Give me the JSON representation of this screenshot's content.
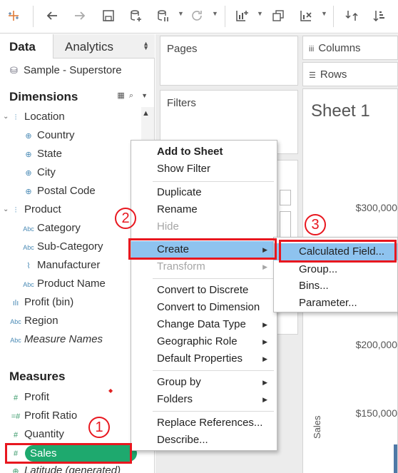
{
  "toolbar": {
    "icons": [
      "tableau-logo-icon",
      "undo-icon",
      "redo-icon",
      "save-icon",
      "new-datasource-icon",
      "pause-updates-icon",
      "refresh-icon",
      "new-worksheet-icon",
      "duplicate-icon",
      "clear-sheet-icon",
      "swap-icon",
      "sort-ascending-icon"
    ]
  },
  "left_pane": {
    "tab_data": "Data",
    "tab_analytics": "Analytics",
    "datasource": "Sample - Superstore",
    "dimensions_header": "Dimensions",
    "measures_header": "Measures",
    "dimensions": [
      {
        "label": "Location",
        "icon": "hierarchy-icon",
        "level": 0
      },
      {
        "label": "Country",
        "icon": "globe-icon",
        "level": 1
      },
      {
        "label": "State",
        "icon": "globe-icon",
        "level": 1
      },
      {
        "label": "City",
        "icon": "globe-icon",
        "level": 1
      },
      {
        "label": "Postal Code",
        "icon": "globe-icon",
        "level": 1
      },
      {
        "label": "Product",
        "icon": "hierarchy-icon",
        "level": 0
      },
      {
        "label": "Category",
        "icon": "abc-icon",
        "level": 1
      },
      {
        "label": "Sub-Category",
        "icon": "abc-icon",
        "level": 1
      },
      {
        "label": "Manufacturer",
        "icon": "paperclip-icon",
        "level": 1
      },
      {
        "label": "Product Name",
        "icon": "abc-icon",
        "level": 1
      },
      {
        "label": "Profit (bin)",
        "icon": "bin-icon",
        "level": 0
      },
      {
        "label": "Region",
        "icon": "abc-icon",
        "level": 0
      },
      {
        "label": "Measure Names",
        "icon": "abc-icon",
        "level": 0
      }
    ],
    "measures": [
      {
        "label": "Profit"
      },
      {
        "label": "Profit Ratio"
      },
      {
        "label": "Quantity"
      },
      {
        "label": "Sales"
      },
      {
        "label": "Latitude (generated)"
      }
    ]
  },
  "shelves": {
    "pages": "Pages",
    "filters": "Filters",
    "columns": "Columns",
    "rows": "Rows"
  },
  "view": {
    "sheet_title": "Sheet 1",
    "y_axis_title": "Sales",
    "y_ticks": [
      "$300,000",
      "$200,000",
      "$150,000"
    ]
  },
  "context_menu": {
    "items": [
      {
        "label": "Add to Sheet",
        "bold": true
      },
      {
        "label": "Show Filter"
      },
      {
        "label": "Duplicate"
      },
      {
        "label": "Rename"
      },
      {
        "label": "Hide",
        "disabled": true
      },
      {
        "label": "Create",
        "highlighted": true,
        "submenu": true
      },
      {
        "label": "Transform",
        "disabled": true,
        "submenu": true
      },
      {
        "label": "Convert to Discrete"
      },
      {
        "label": "Convert to Dimension"
      },
      {
        "label": "Change Data Type",
        "submenu": true
      },
      {
        "label": "Geographic Role",
        "submenu": true
      },
      {
        "label": "Default Properties",
        "submenu": true
      },
      {
        "label": "Group by",
        "submenu": true
      },
      {
        "label": "Folders",
        "submenu": true
      },
      {
        "label": "Replace References..."
      },
      {
        "label": "Describe..."
      }
    ]
  },
  "create_submenu": {
    "items": [
      {
        "label": "Calculated Field...",
        "highlighted": true
      },
      {
        "label": "Group..."
      },
      {
        "label": "Bins..."
      },
      {
        "label": "Parameter..."
      }
    ]
  },
  "annotations": {
    "step1": "1",
    "step2": "2",
    "step3": "3",
    "color": "#e8171f"
  },
  "colors": {
    "highlight": "#8ec3ef",
    "sales_pill": "#1ea96e",
    "dimension_blue": "#4a8ab5",
    "measure_green": "#3a9a6a"
  }
}
